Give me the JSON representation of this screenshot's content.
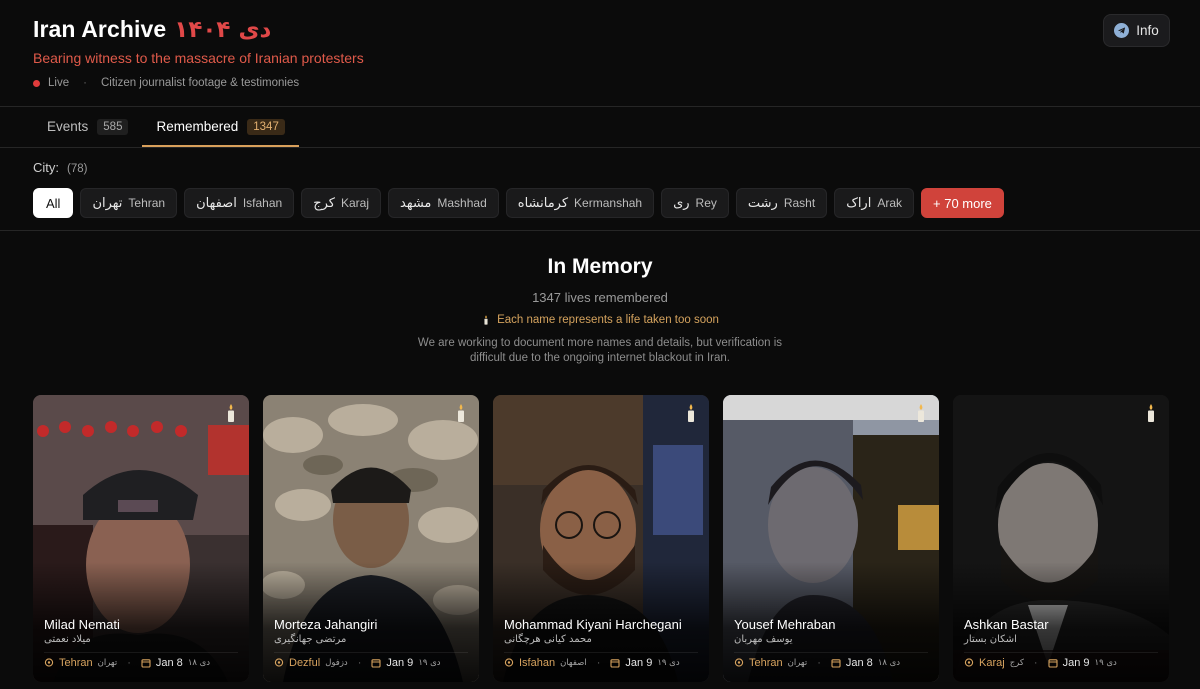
{
  "header": {
    "title": "Iran Archive",
    "title_fa": "دی ۱۴۰۴",
    "subtitle": "Bearing witness to the massacre of Iranian protesters",
    "live_label": "Live",
    "meta_text": "Citizen journalist footage & testimonies",
    "info_label": "Info"
  },
  "tabs": [
    {
      "label": "Events",
      "count": "585"
    },
    {
      "label": "Remembered",
      "count": "1347"
    }
  ],
  "city_filter": {
    "label": "City:",
    "count": "(78)",
    "all_label": "All",
    "chips": [
      {
        "fa": "تهران",
        "en": "Tehran"
      },
      {
        "fa": "اصفهان",
        "en": "Isfahan"
      },
      {
        "fa": "کرج",
        "en": "Karaj"
      },
      {
        "fa": "مشهد",
        "en": "Mashhad"
      },
      {
        "fa": "کرمانشاه",
        "en": "Kermanshah"
      },
      {
        "fa": "ری",
        "en": "Rey"
      },
      {
        "fa": "رشت",
        "en": "Rasht"
      },
      {
        "fa": "اراک",
        "en": "Arak"
      }
    ],
    "more_label": "+ 70 more"
  },
  "memory": {
    "title": "In Memory",
    "count_text": "1347 lives remembered",
    "note": "Each name represents a life taken too soon",
    "description": "We are working to document more names and details, but verification is difficult due to the ongoing internet blackout in Iran."
  },
  "cards": [
    {
      "name": "Milad Nemati",
      "name_fa": "میلاد نعمتی",
      "city": "Tehran",
      "city_fa": "تهران",
      "date": "Jan 8",
      "date_fa": "۱۸ دی"
    },
    {
      "name": "Morteza Jahangiri",
      "name_fa": "مرتضی جهانگیری",
      "city": "Dezful",
      "city_fa": "دزفول",
      "date": "Jan 9",
      "date_fa": "۱۹ دی"
    },
    {
      "name": "Mohammad Kiyani Harchegani",
      "name_fa": "محمد کیانی هرچگانی",
      "city": "Isfahan",
      "city_fa": "اصفهان",
      "date": "Jan 9",
      "date_fa": "۱۹ دی"
    },
    {
      "name": "Yousef Mehraban",
      "name_fa": "یوسف مهربان",
      "city": "Tehran",
      "city_fa": "تهران",
      "date": "Jan 8",
      "date_fa": "۱۸ دی"
    },
    {
      "name": "Ashkan Bastar",
      "name_fa": "اشکان بستار",
      "city": "Karaj",
      "city_fa": "کرج",
      "date": "Jan 9",
      "date_fa": "۱۹ دی"
    }
  ],
  "icons": {
    "telegram": "telegram-icon",
    "candle": "candle-icon",
    "location": "location-pin-icon",
    "calendar": "calendar-icon"
  },
  "colors": {
    "accent_red": "#e04848",
    "accent_gold": "#d9a05b",
    "more_chip": "#d0433b"
  }
}
